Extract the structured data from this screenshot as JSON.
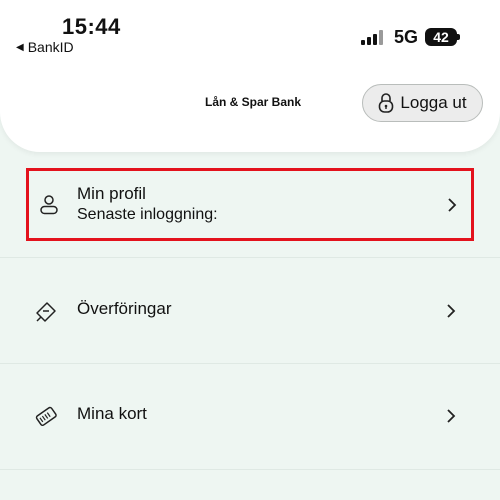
{
  "status_bar": {
    "time": "15:44",
    "back_app": "BankID",
    "network": "5G",
    "battery": "42"
  },
  "header": {
    "bank_name": "Lån & Spar Bank",
    "logout_label": "Logga ut"
  },
  "menu": {
    "profile": {
      "title": "Min profil",
      "subtitle": "Senaste inloggning:"
    },
    "transfers": {
      "label": "Överföringar"
    },
    "cards": {
      "label": "Mina kort"
    }
  },
  "colors": {
    "background": "#eef6f2",
    "highlight_border": "#e3121d"
  },
  "icons": {
    "back": "back-arrow-icon",
    "signal": "signal-icon",
    "lock": "lock-icon",
    "profile": "person-icon",
    "transfers": "transfer-icon",
    "cards": "card-icon",
    "chevron": "chevron-right-icon"
  }
}
